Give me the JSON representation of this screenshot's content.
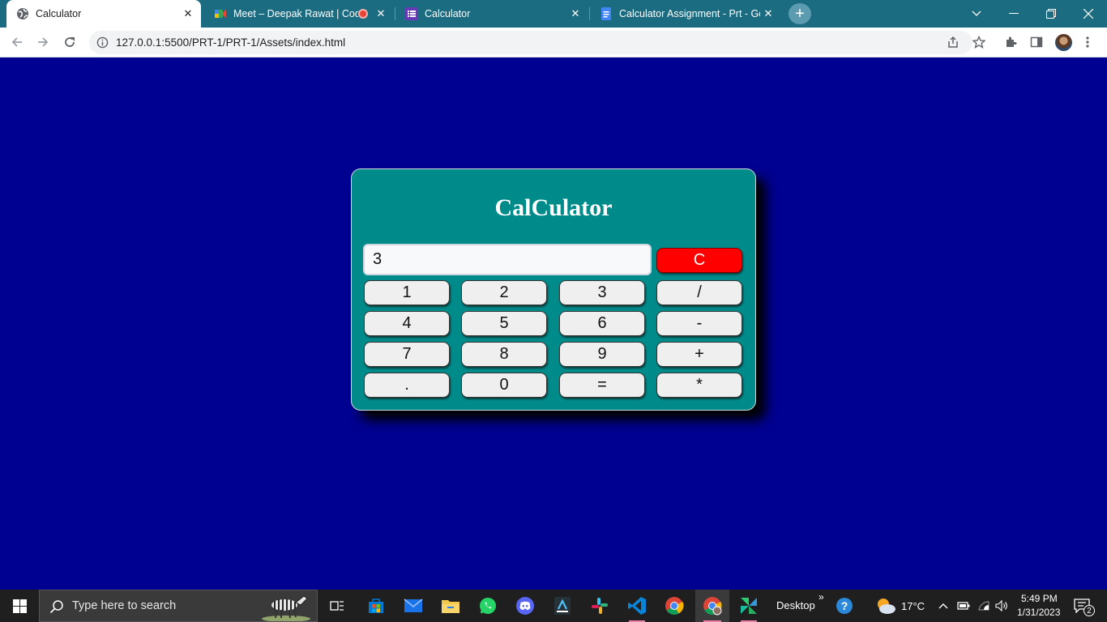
{
  "browser": {
    "tabs": [
      {
        "title": "Calculator",
        "active": true
      },
      {
        "title": "Meet – Deepak Rawat | Codi",
        "active": false
      },
      {
        "title": "Calculator",
        "active": false
      },
      {
        "title": "Calculator Assignment - Prt - Goo",
        "active": false
      }
    ],
    "url": {
      "host": "127.0.0.1",
      "rest": ":5500/PRT-1/PRT-1/Assets/index.html"
    }
  },
  "calculator": {
    "title": "CalCulator",
    "display_value": "3",
    "clear_label": "C",
    "keys": [
      "1",
      "2",
      "3",
      "/",
      "4",
      "5",
      "6",
      "-",
      "7",
      "8",
      "9",
      "+",
      ".",
      "0",
      "=",
      "*"
    ]
  },
  "taskbar": {
    "search_placeholder": "Type here to search",
    "desktop_label": "Desktop",
    "chevron": "»",
    "temperature": "17°C",
    "time": "5:49 PM",
    "date": "1/31/2023",
    "notification_count": "2"
  },
  "colors": {
    "page_background": "#000091",
    "calculator_panel": "#008b8b",
    "clear_button": "#ff0000",
    "tab_strip": "#1b6c80"
  }
}
